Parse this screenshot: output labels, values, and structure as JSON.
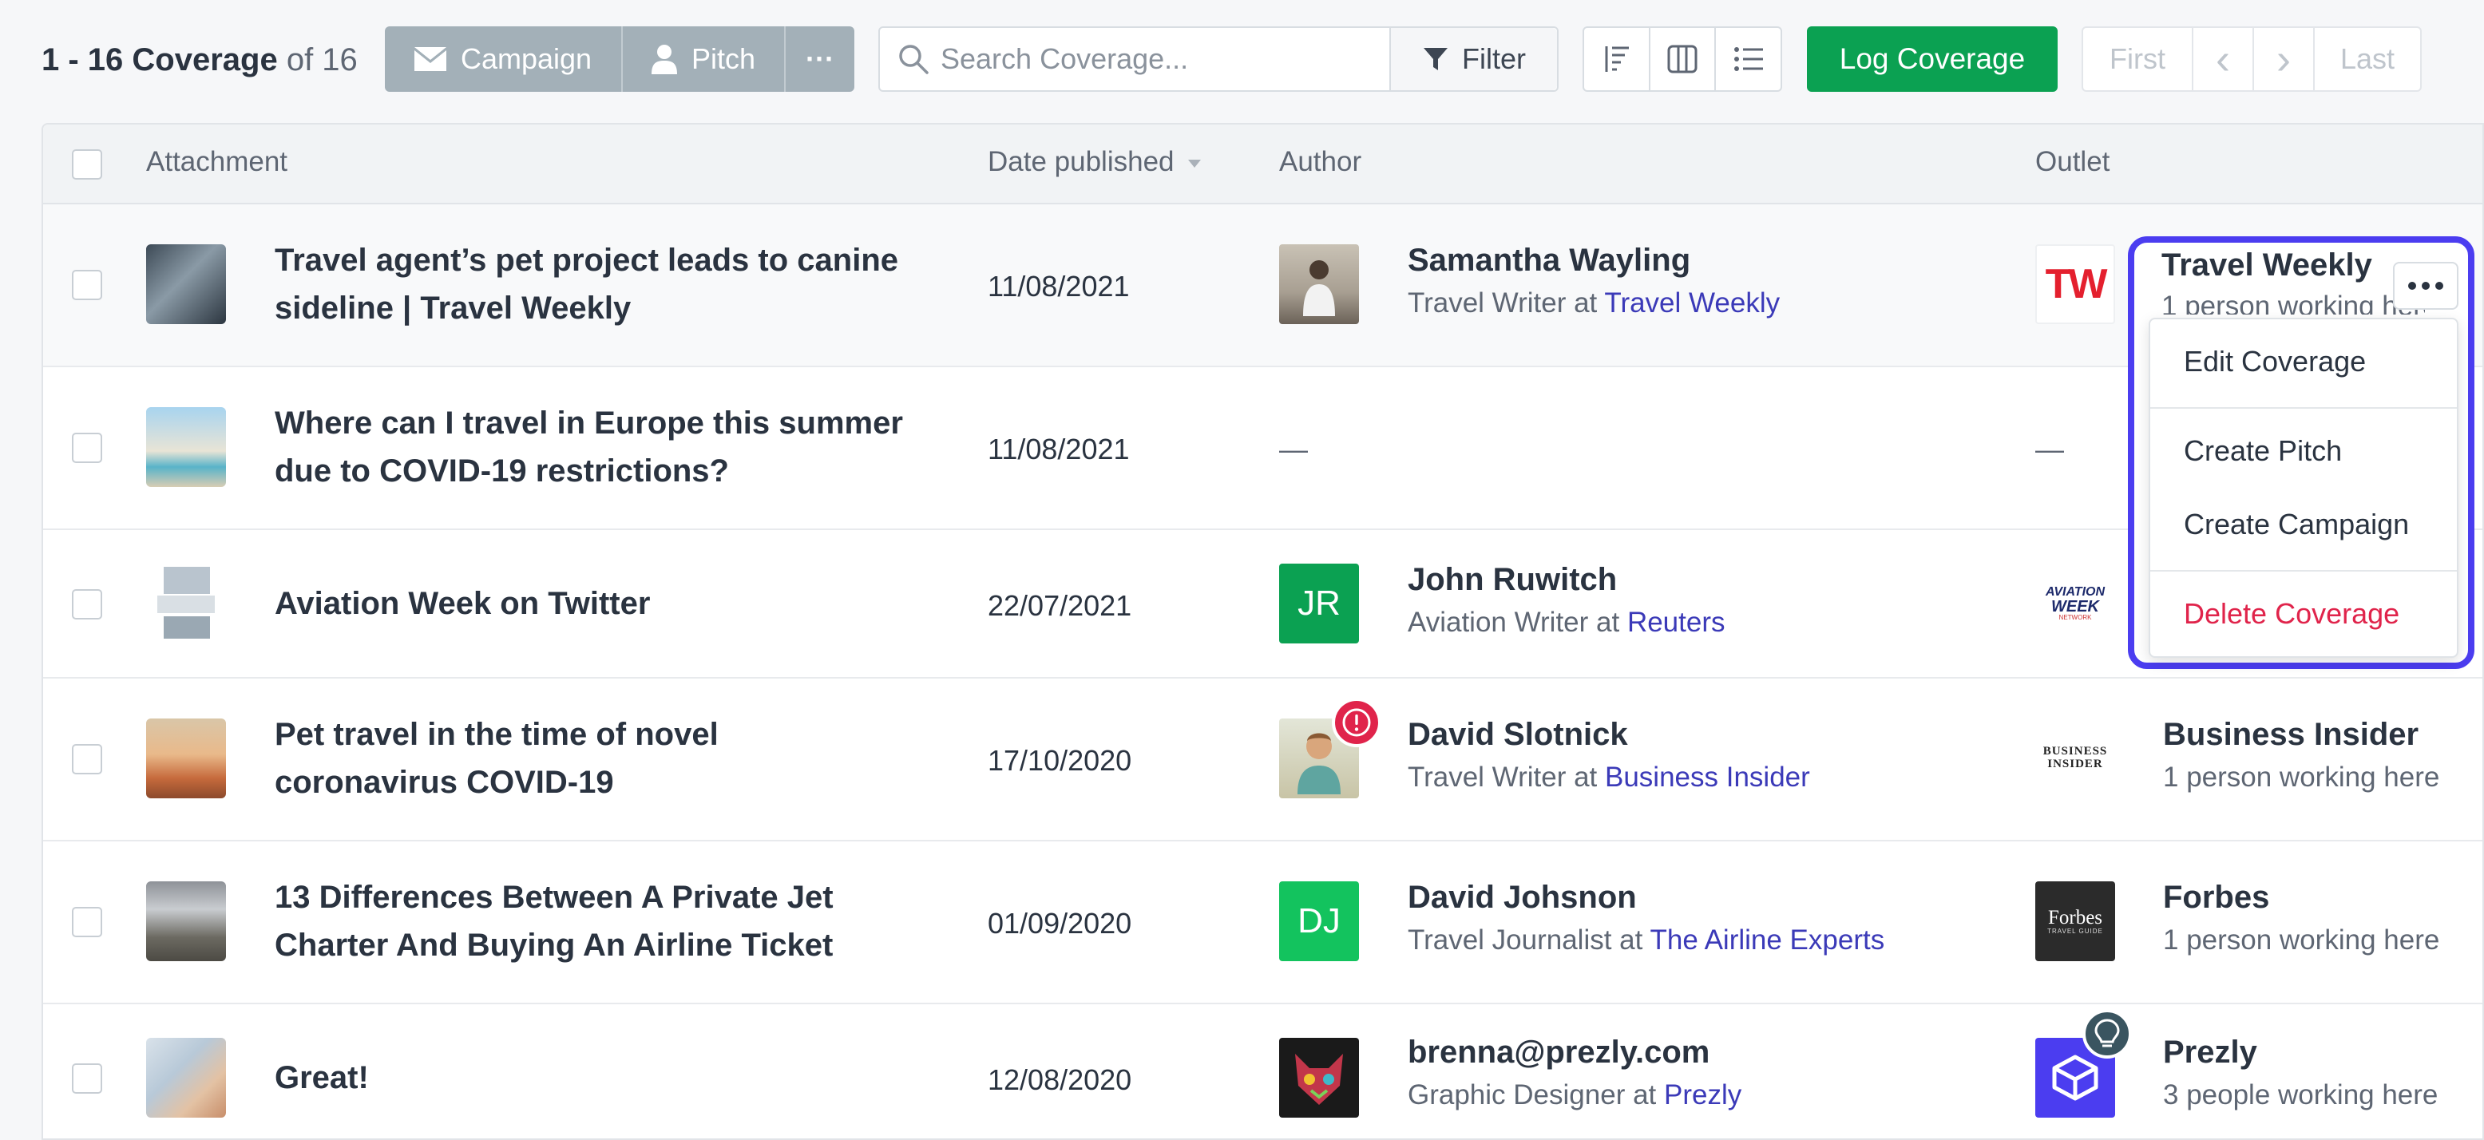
{
  "toolbar": {
    "range": "1 - 16 Coverage",
    "of_total": "of 16",
    "campaign_label": "Campaign",
    "pitch_label": "Pitch",
    "more_label": "···",
    "search_placeholder": "Search Coverage...",
    "filter_label": "Filter",
    "log_coverage_label": "Log Coverage",
    "pager": {
      "first": "First",
      "prev": "‹",
      "next": "›",
      "last": "Last"
    }
  },
  "table": {
    "columns": {
      "attachment": "Attachment",
      "date_published": "Date published",
      "author": "Author",
      "outlet": "Outlet"
    },
    "rows": [
      {
        "title_line1": "Travel agent’s pet project leads to canine",
        "title_line2": "sideline | Travel Weekly",
        "date": "11/08/2021",
        "author_name": "Samantha Wayling",
        "author_role": "Travel Writer at ",
        "author_org": "Travel Weekly",
        "outlet_logo": "TW",
        "outlet_name": "Travel Weekly",
        "outlet_sub": "1 person working here"
      },
      {
        "title_line1": "Where can I travel in Europe this summer",
        "title_line2": "due to COVID-19 restrictions?",
        "date": "11/08/2021",
        "author_dash": "—",
        "outlet_dash": "—"
      },
      {
        "title_line1": "Aviation Week on Twitter",
        "date": "22/07/2021",
        "author_initials": "JR",
        "author_name": "John Ruwitch",
        "author_role": "Aviation Writer at ",
        "author_org": "Reuters",
        "outlet_logo_line1": "AVIATION",
        "outlet_logo_line2": "WEEK",
        "outlet_logo_line3": "NETWORK"
      },
      {
        "title_line1": "Pet travel in the time of novel",
        "title_line2": "coronavirus COVID-19",
        "date": "17/10/2020",
        "badge": "!",
        "author_name": "David Slotnick",
        "author_role": "Travel Writer at ",
        "author_org": "Business Insider",
        "outlet_logo_line1": "BUSINESS",
        "outlet_logo_line2": "INSIDER",
        "outlet_name": "Business Insider",
        "outlet_sub": "1 person working here"
      },
      {
        "title_line1": "13 Differences Between A Private Jet",
        "title_line2": "Charter And Buying An Airline Ticket",
        "date": "01/09/2020",
        "author_initials": "DJ",
        "author_name": "David Johsnon",
        "author_role": "Travel Journalist at ",
        "author_org": "The Airline Experts",
        "outlet_logo": "Forbes",
        "outlet_logo_sub": "TRAVEL GUIDE",
        "outlet_name": "Forbes",
        "outlet_sub": "1 person working here"
      },
      {
        "title_line1": "Great!",
        "date": "12/08/2020",
        "author_name": "brenna@prezly.com",
        "author_role": "Graphic Designer at ",
        "author_org": "Prezly",
        "outlet_name": "Prezly",
        "outlet_sub": "3 people working here"
      }
    ]
  },
  "menu": {
    "edit": "Edit Coverage",
    "create_pitch": "Create Pitch",
    "create_campaign": "Create Campaign",
    "delete": "Delete Coverage"
  },
  "colors": {
    "accent_green": "#0ba152",
    "highlight": "#4b3df0",
    "danger": "#e0244b",
    "link": "#3b3ab8"
  },
  "icons": [
    "envelope-icon",
    "person-icon",
    "search-icon",
    "filter-icon",
    "sort-icon",
    "columns-icon",
    "list-icon",
    "sort-arrow-icon",
    "alert-icon",
    "lightbulb-icon",
    "more-icon"
  ]
}
